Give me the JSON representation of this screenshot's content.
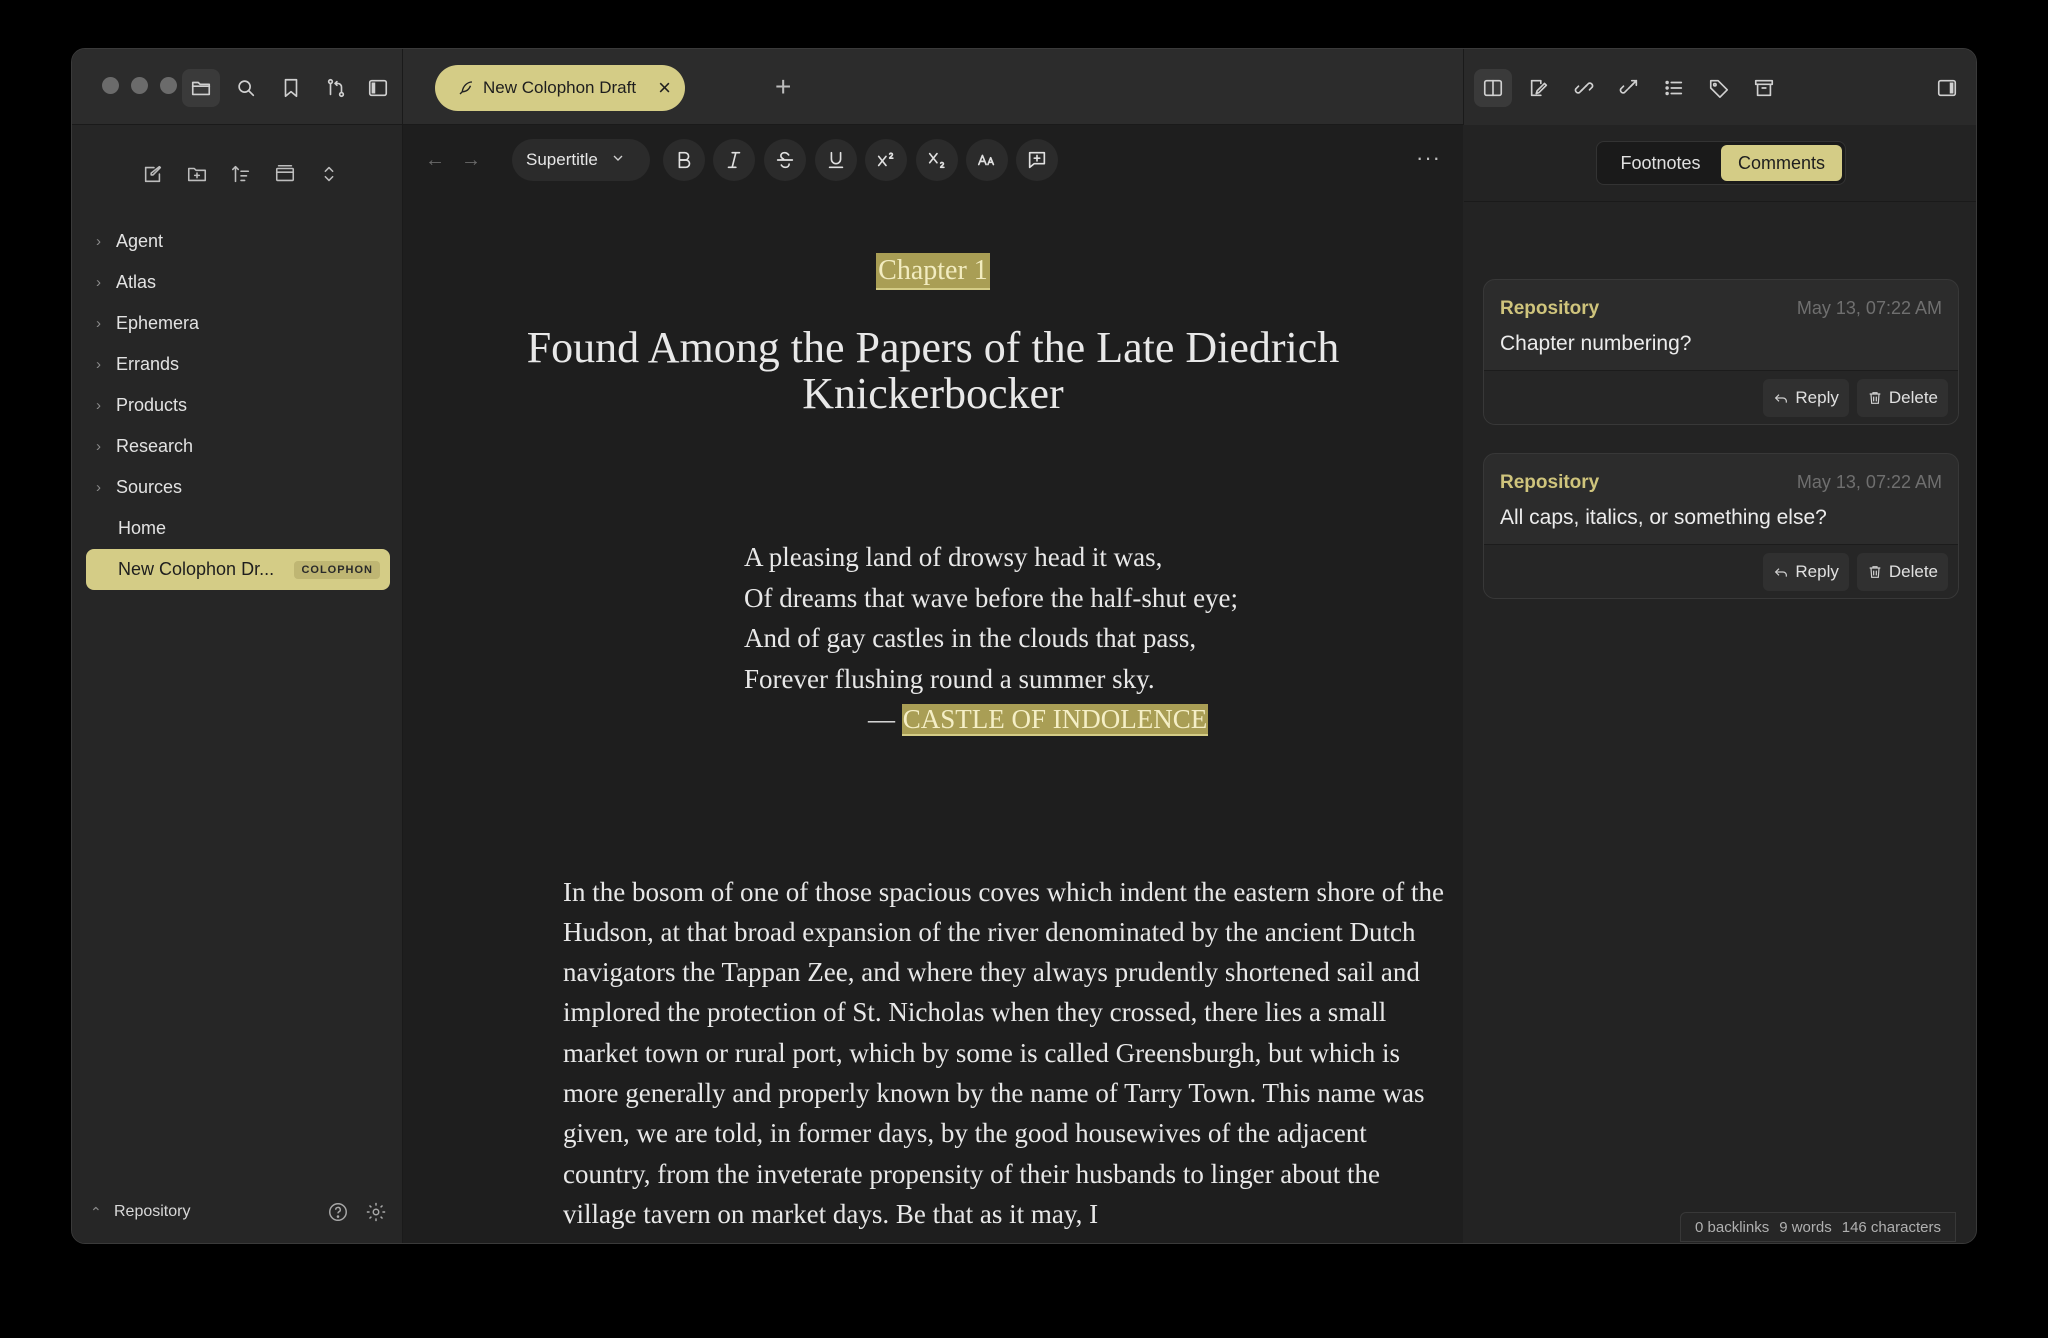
{
  "titlebar": {
    "tab_label": "New Colophon Draft",
    "new_tab": "+"
  },
  "sidebar": {
    "items": [
      {
        "label": "Agent",
        "expandable": true
      },
      {
        "label": "Atlas",
        "expandable": true
      },
      {
        "label": "Ephemera",
        "expandable": true
      },
      {
        "label": "Errands",
        "expandable": true
      },
      {
        "label": "Products",
        "expandable": true
      },
      {
        "label": "Research",
        "expandable": true
      },
      {
        "label": "Sources",
        "expandable": true
      },
      {
        "label": "Home",
        "expandable": false
      },
      {
        "label": "New Colophon Dr...",
        "expandable": false,
        "selected": true,
        "badge": "COLOPHON"
      }
    ],
    "footer_repo": "Repository"
  },
  "editor": {
    "style_select": "Supertitle",
    "chapter": "Chapter 1",
    "title": "Found Among the Papers of the Late Diedrich Knickerbocker",
    "poem": [
      "A pleasing land of drowsy head it was,",
      "Of dreams that wave before the half-shut eye;",
      "And of gay castles in the clouds that pass,",
      "Forever flushing round a summer sky."
    ],
    "attribution_dash": "— ",
    "attribution": "CASTLE OF INDOLENCE",
    "paragraph": "In the bosom of one of those spacious coves which indent the eastern shore of the Hudson, at that broad expansion of the river denominated by the ancient Dutch navigators the Tappan Zee, and where they always prudently shortened sail and implored the protection of St. Nicholas when they crossed, there lies a small market town or rural port, which by some is called Greensburgh, but which is more generally and properly known by the name of Tarry Town. This name was given, we are told, in former days, by the good housewives of the adjacent country, from the inveterate propensity of their husbands to linger about the village tavern on market days. Be that as it may, I"
  },
  "right_panel": {
    "tabs": [
      "Footnotes",
      "Comments"
    ],
    "active_tab": "Comments",
    "comments": [
      {
        "author": "Repository",
        "date": "May 13, 07:22 AM",
        "text": "Chapter numbering?",
        "reply": "Reply",
        "delete": "Delete"
      },
      {
        "author": "Repository",
        "date": "May 13, 07:22 AM",
        "text": "All caps, italics, or something else?",
        "reply": "Reply",
        "delete": "Delete"
      }
    ]
  },
  "status_bar": {
    "backlinks": "0 backlinks",
    "words": "9 words",
    "characters": "146 characters"
  },
  "colors": {
    "accent": "#d4cc86",
    "highlight": "#a99e55",
    "background": "#1e1e1e"
  }
}
